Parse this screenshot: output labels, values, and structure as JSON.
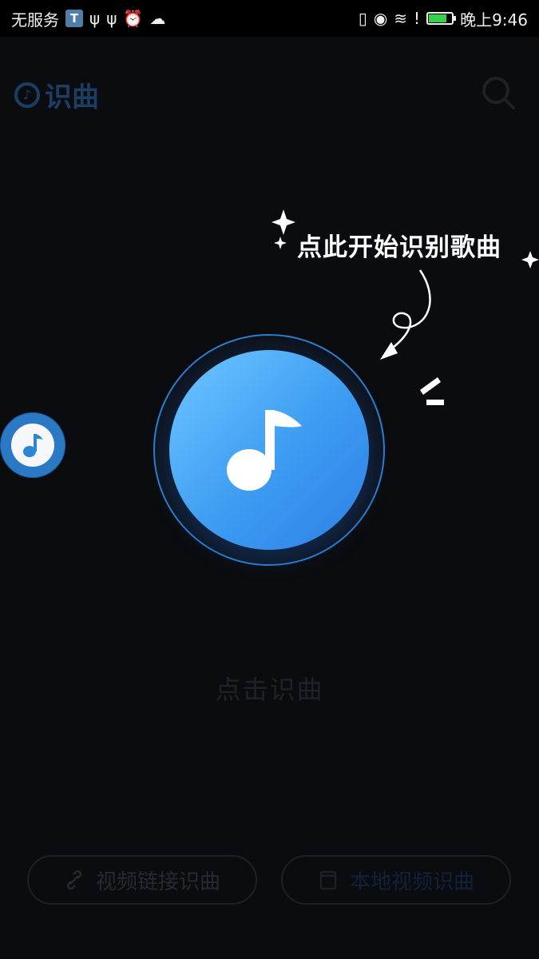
{
  "status_bar": {
    "carrier": "无服务",
    "badge": "T",
    "time": "晚上9:46",
    "battery_level": 0.72
  },
  "header": {
    "brand_label": "识曲",
    "brand_color": "#1c3e63",
    "search_icon": "search-icon"
  },
  "hint": {
    "text": "点此开始识别歌曲"
  },
  "main": {
    "tap_label": "点击识曲",
    "accent_color": "#3d9cf2"
  },
  "actions": [
    {
      "label": "视频链接识曲",
      "icon": "link-icon"
    },
    {
      "label": "本地视频识曲",
      "icon": "file-icon"
    }
  ]
}
